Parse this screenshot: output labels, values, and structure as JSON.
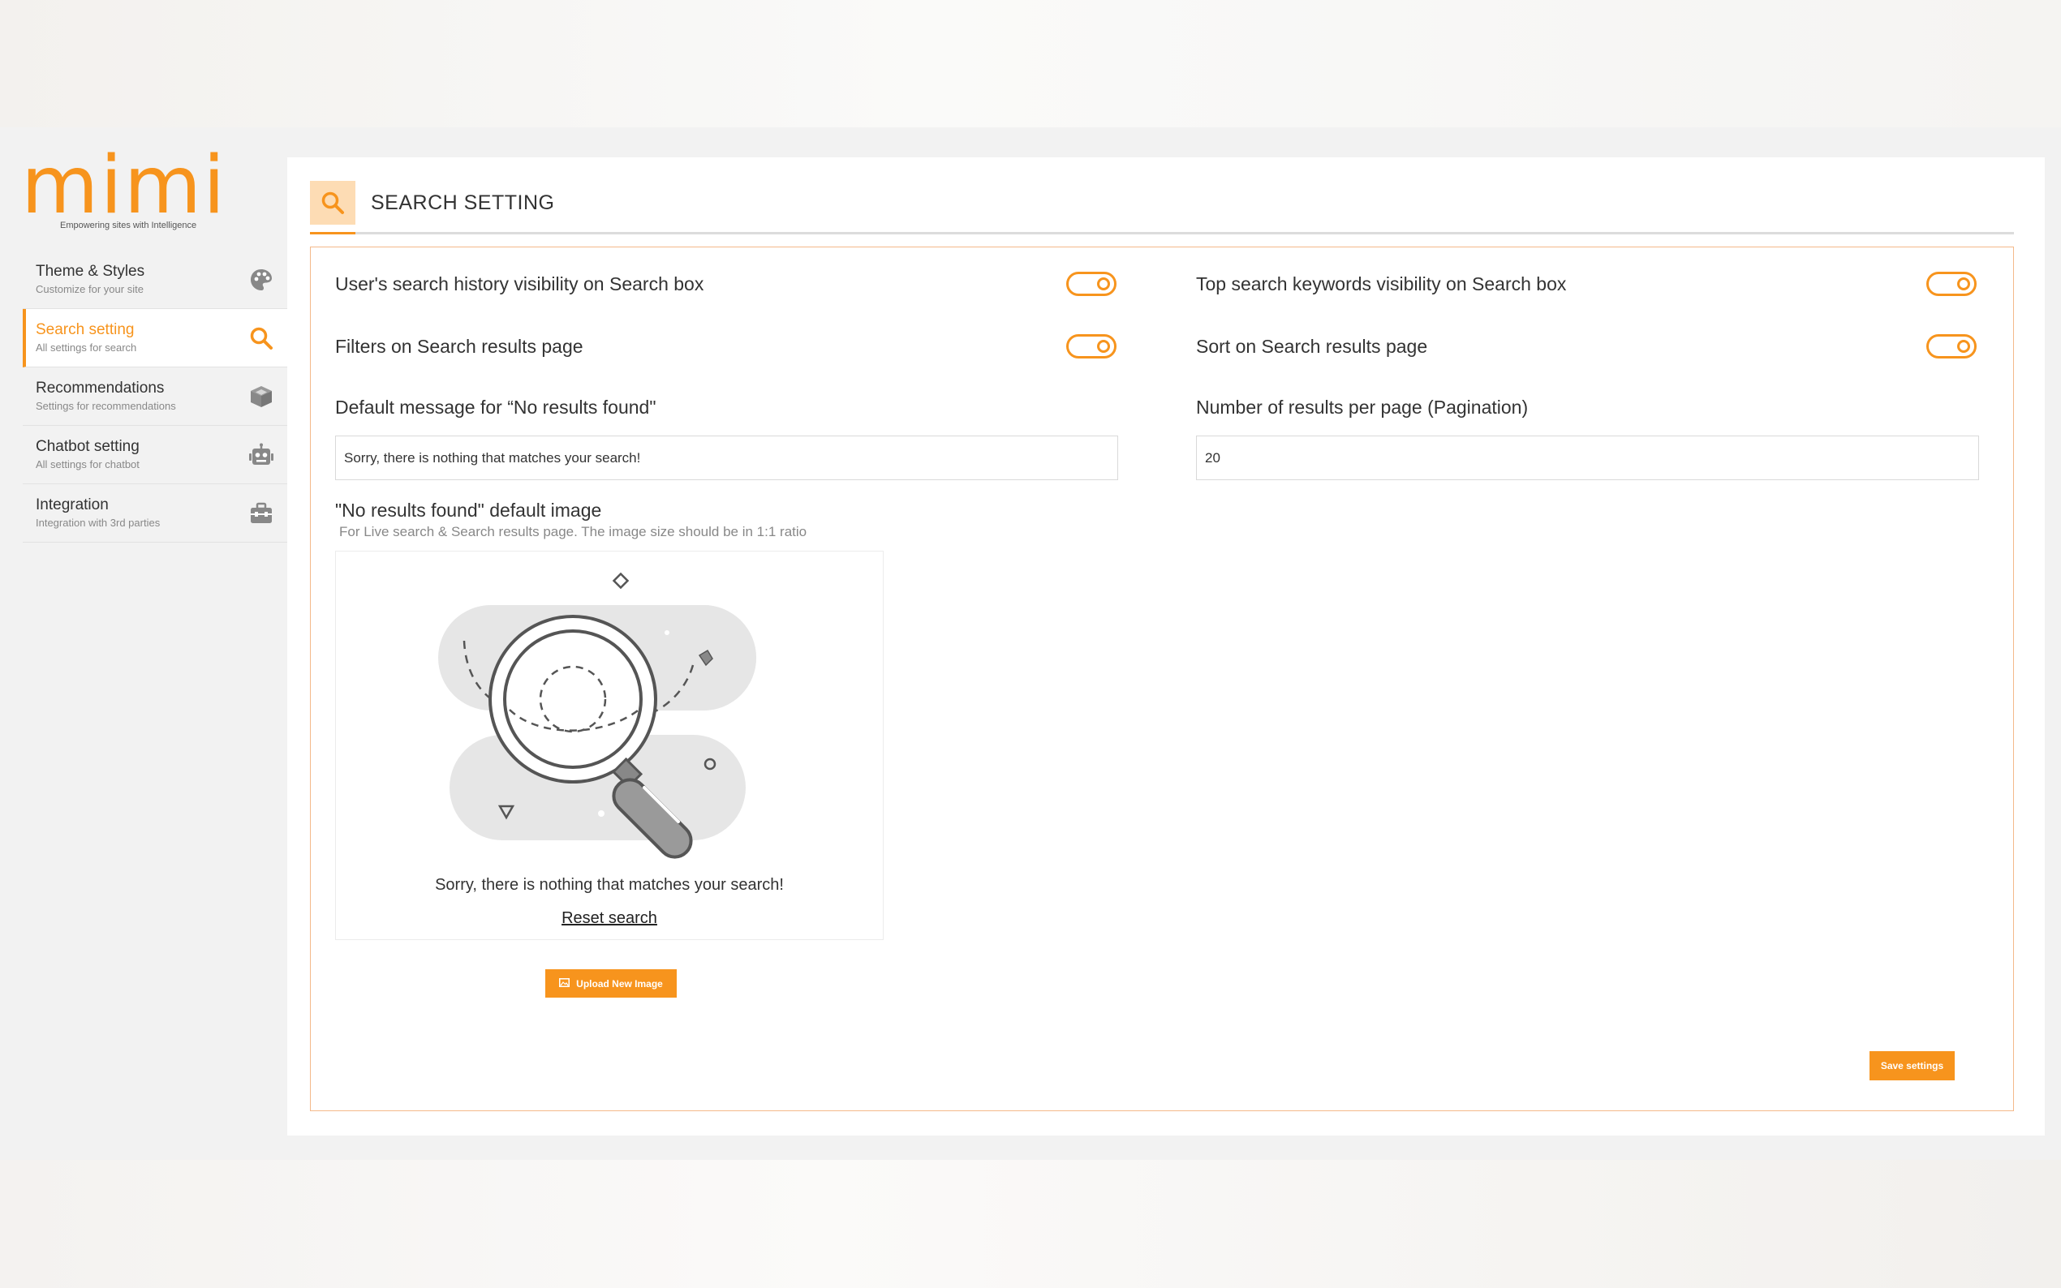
{
  "brand": {
    "logo_text": "mimi",
    "tagline": "Empowering sites with Intelligence",
    "accent_color": "#f7941d"
  },
  "sidebar": {
    "items": [
      {
        "title": "Theme & Styles",
        "subtitle": "Customize for your site",
        "icon": "palette-icon",
        "active": false
      },
      {
        "title": "Search setting",
        "subtitle": "All settings for search",
        "icon": "search-icon",
        "active": true
      },
      {
        "title": "Recommendations",
        "subtitle": "Settings for recommendations",
        "icon": "box-icon",
        "active": false
      },
      {
        "title": "Chatbot setting",
        "subtitle": "All settings for chatbot",
        "icon": "robot-icon",
        "active": false
      },
      {
        "title": "Integration",
        "subtitle": "Integration with 3rd parties",
        "icon": "toolbox-icon",
        "active": false
      }
    ]
  },
  "page": {
    "title": "SEARCH SETTING",
    "icon": "search-icon"
  },
  "settings": {
    "history_visibility": {
      "label": "User's search history visibility on Search box",
      "enabled": true
    },
    "top_keywords_visibility": {
      "label": "Top search keywords visibility on Search box",
      "enabled": true
    },
    "filters_results_page": {
      "label": "Filters on Search results page",
      "enabled": true
    },
    "sort_results_page": {
      "label": "Sort on Search results page",
      "enabled": true
    },
    "default_message": {
      "label": "Default message for “No results found\"",
      "value": "Sorry, there is nothing that matches your search!"
    },
    "results_per_page": {
      "label": "Number of results per page (Pagination)",
      "value": "20"
    },
    "no_results_image": {
      "label": "\"No results found\" default image",
      "hint": "For Live search & Search results page. The image size should be in 1:1 ratio",
      "preview_message": "Sorry, there is nothing that matches your search!",
      "preview_link": "Reset search",
      "upload_label": "Upload New Image"
    },
    "save_label": "Save settings"
  }
}
